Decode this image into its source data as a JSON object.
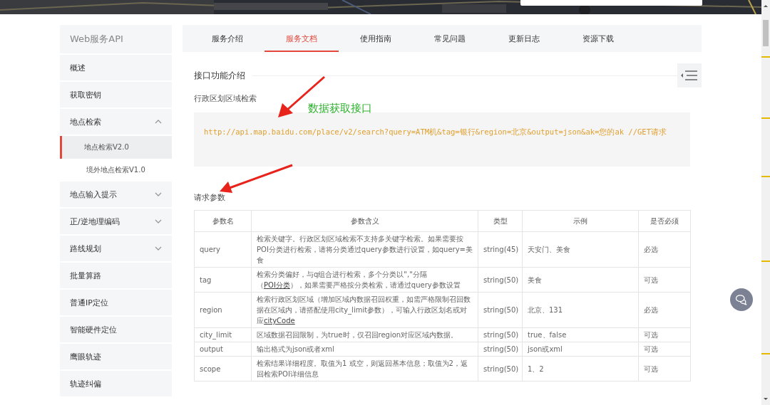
{
  "sidebar": {
    "title": "Web服务API",
    "items": [
      {
        "label": "概述",
        "kind": "link",
        "selected": false
      },
      {
        "label": "获取密钥",
        "kind": "link",
        "selected": false
      },
      {
        "label": "地点检索",
        "kind": "group",
        "expanded": true,
        "selected": false,
        "children": [
          {
            "label": "地点检索V2.0",
            "selected": true
          },
          {
            "label": "境外地点检索V1.0",
            "selected": false
          }
        ]
      },
      {
        "label": "地点输入提示",
        "kind": "group",
        "expanded": false,
        "selected": false
      },
      {
        "label": "正/逆地理编码",
        "kind": "group",
        "expanded": false,
        "selected": false
      },
      {
        "label": "路线规划",
        "kind": "group",
        "expanded": false,
        "selected": false
      },
      {
        "label": "批量算路",
        "kind": "link",
        "selected": false
      },
      {
        "label": "普通IP定位",
        "kind": "link",
        "selected": false
      },
      {
        "label": "智能硬件定位",
        "kind": "link",
        "selected": false
      },
      {
        "label": "鹰眼轨迹",
        "kind": "link",
        "selected": false
      },
      {
        "label": "轨迹纠偏",
        "kind": "link",
        "selected": false
      }
    ]
  },
  "tabs": [
    {
      "label": "服务介绍",
      "selected": false
    },
    {
      "label": "服务文档",
      "selected": true
    },
    {
      "label": "使用指南",
      "selected": false
    },
    {
      "label": "常见问题",
      "selected": false
    },
    {
      "label": "更新日志",
      "selected": false
    },
    {
      "label": "资源下载",
      "selected": false
    }
  ],
  "section_title": "接口功能介绍",
  "subtitle": "行政区划区域检索",
  "annotation": "数据获取接口",
  "code": "http://api.map.baidu.com/place/v2/search?query=ATM机&tag=银行&region=北京&output=json&ak=您的ak //GET请求",
  "params_title": "请求参数",
  "table": {
    "columns": [
      "参数名",
      "参数含义",
      "类型",
      "示例",
      "是否必须"
    ],
    "rows": [
      {
        "name": "query",
        "desc": [
          {
            "text": "检索关键字。行政区划区域检索不支持多关键字检索。如果需要按POI分类进行检索，请将分类通过query参数进行设置，如query=美食",
            "link": false
          }
        ],
        "type": "string(45)",
        "example": "天安门、美食",
        "required": "必选"
      },
      {
        "name": "tag",
        "desc": [
          {
            "text": "检索分类偏好，与q组合进行检索，多个分类以\",\"分隔（",
            "link": false
          },
          {
            "text": "POI分类",
            "link": true
          },
          {
            "text": "），如果需要严格按分类检索，请通过query参数设置",
            "link": false
          }
        ],
        "type": "string(50)",
        "example": "美食",
        "required": "可选"
      },
      {
        "name": "region",
        "desc": [
          {
            "text": "检索行政区划区域（增加区域内数据召回权重，如需严格限制召回数据在区域内，请搭配使用city_limit参数），可输入行政区划名或对应",
            "link": false
          },
          {
            "text": "cityCode",
            "link": true
          }
        ],
        "type": "string(50)",
        "example": "北京、131",
        "required": "必选"
      },
      {
        "name": "city_limit",
        "desc": [
          {
            "text": "区域数据召回限制，为true时，仅召回region对应区域内数据。",
            "link": false
          }
        ],
        "type": "string(50)",
        "example": "true、false",
        "required": "可选"
      },
      {
        "name": "output",
        "desc": [
          {
            "text": "输出格式为json或者xml",
            "link": false
          }
        ],
        "type": "string(50)",
        "example": "json或xml",
        "required": "可选"
      },
      {
        "name": "scope",
        "desc": [
          {
            "text": "检索结果详细程度。取值为1 或空，则返回基本信息；取值为2，返回检索POI详细信息",
            "link": false
          }
        ],
        "type": "string(50)",
        "example": "1、2",
        "required": "可选"
      }
    ]
  }
}
